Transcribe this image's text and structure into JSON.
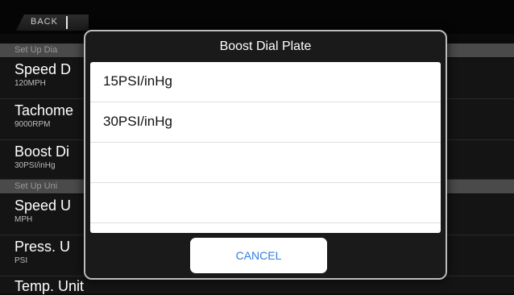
{
  "header": {
    "back_label": "BACK"
  },
  "sections": {
    "setup_dial": "Set Up Dia",
    "setup_unit": "Set Up Uni"
  },
  "rows": [
    {
      "title": "Speed D",
      "subtitle": "120MPH"
    },
    {
      "title": "Tachome",
      "subtitle": "9000RPM"
    },
    {
      "title": "Boost Di",
      "subtitle": "30PSI/inHg"
    },
    {
      "title": "Speed U",
      "subtitle": "MPH"
    },
    {
      "title": "Press. U",
      "subtitle": "PSI"
    },
    {
      "title": "Temp. Unit",
      "subtitle": ""
    }
  ],
  "dialog": {
    "title": "Boost Dial Plate",
    "options": [
      "15PSI/inHg",
      "30PSI/inHg",
      "",
      "",
      ""
    ],
    "cancel_label": "CANCEL"
  },
  "colors": {
    "background": "#0b0b0b",
    "section_bar": "#4a4a4a",
    "cancel_text": "#2f7de1"
  }
}
